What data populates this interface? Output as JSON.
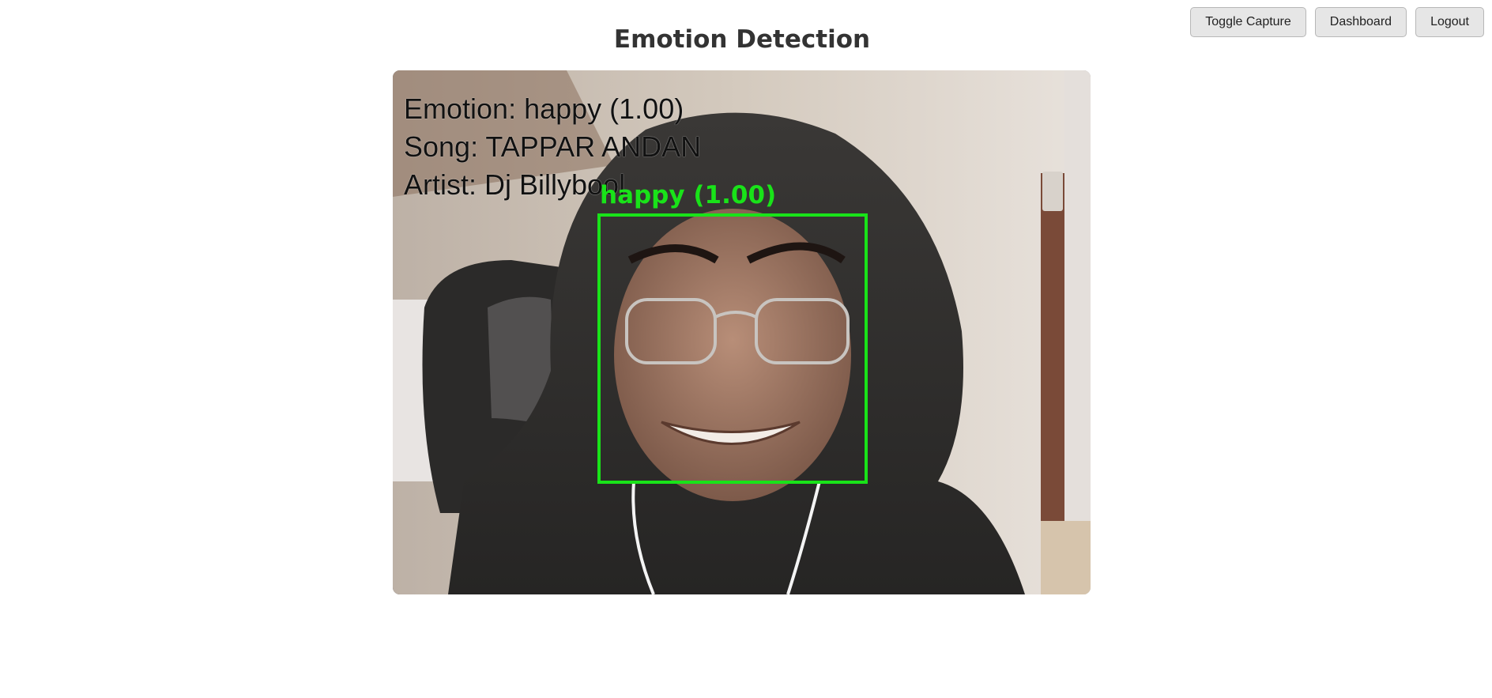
{
  "header": {
    "title": "Emotion Detection"
  },
  "toolbar": {
    "toggle_capture_label": "Toggle Capture",
    "dashboard_label": "Dashboard",
    "logout_label": "Logout"
  },
  "video": {
    "overlay": {
      "emotion_line": "Emotion: happy (1.00)",
      "song_line": "Song: TAPPAR ANDAN",
      "artist_line": "Artist: Dj Billybool"
    },
    "face_detection": {
      "label": "happy (1.00)"
    }
  },
  "colors": {
    "detection_box": "#19e319",
    "button_bg": "#e6e6e6"
  }
}
